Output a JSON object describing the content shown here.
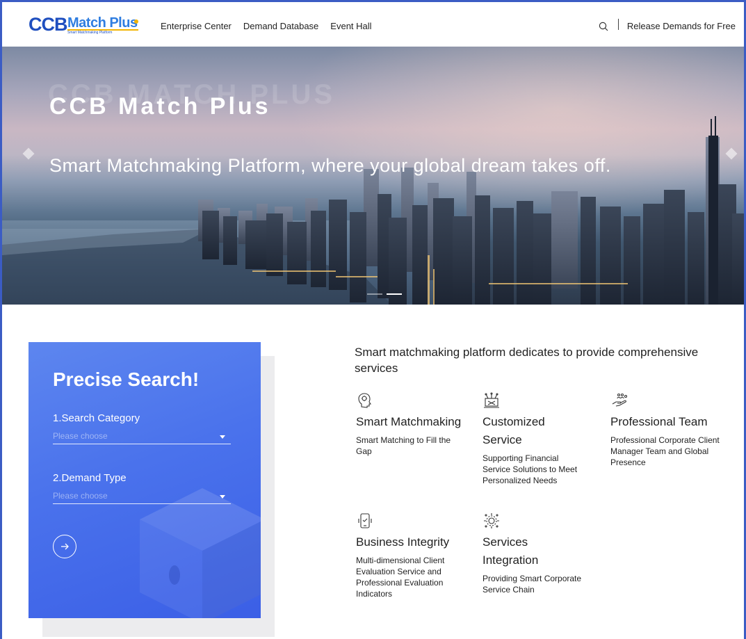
{
  "nav": {
    "logo": {
      "ccb": "CCB",
      "match": "Match Plus",
      "tagline": "Smart Matchmaking Platform"
    },
    "links": [
      {
        "label": "Enterprise Center"
      },
      {
        "label": "Demand Database"
      },
      {
        "label": "Event Hall"
      }
    ],
    "search_icon": "search-icon",
    "release_label": "Release Demands for Free"
  },
  "hero": {
    "watermark": "CCB MATCH PLUS",
    "title": "CCB Match Plus",
    "subtitle": "Smart Matchmaking Platform, where your global dream takes off."
  },
  "search_card": {
    "title": "Precise Search!",
    "fields": [
      {
        "label": "1.Search Category",
        "placeholder": "Please choose"
      },
      {
        "label": "2.Demand Type",
        "placeholder": "Please choose"
      }
    ],
    "submit_icon": "arrow-right-icon",
    "accent_color": "#4a72ec"
  },
  "services": {
    "heading": "Smart matchmaking platform dedicates to provide comprehensive services",
    "items": [
      {
        "icon": "brain-head-icon",
        "title": "Smart Matchmaking",
        "desc": "Smart Matching to Fill the Gap"
      },
      {
        "icon": "network-laptop-icon",
        "title": "Customized Service",
        "desc": "Supporting Financial Service Solutions to Meet Personalized Needs"
      },
      {
        "icon": "hand-people-icon",
        "title": "Professional Team",
        "desc": "Professional Corporate Client Manager Team and Global Presence"
      },
      {
        "icon": "phone-check-icon",
        "title": "Business Integrity",
        "desc": "Multi-dimensional Client Evaluation Service and Professional Evaluation Indicators"
      },
      {
        "icon": "gear-network-icon",
        "title": "Services Integration",
        "desc": "Providing Smart Corporate Service Chain"
      }
    ]
  }
}
